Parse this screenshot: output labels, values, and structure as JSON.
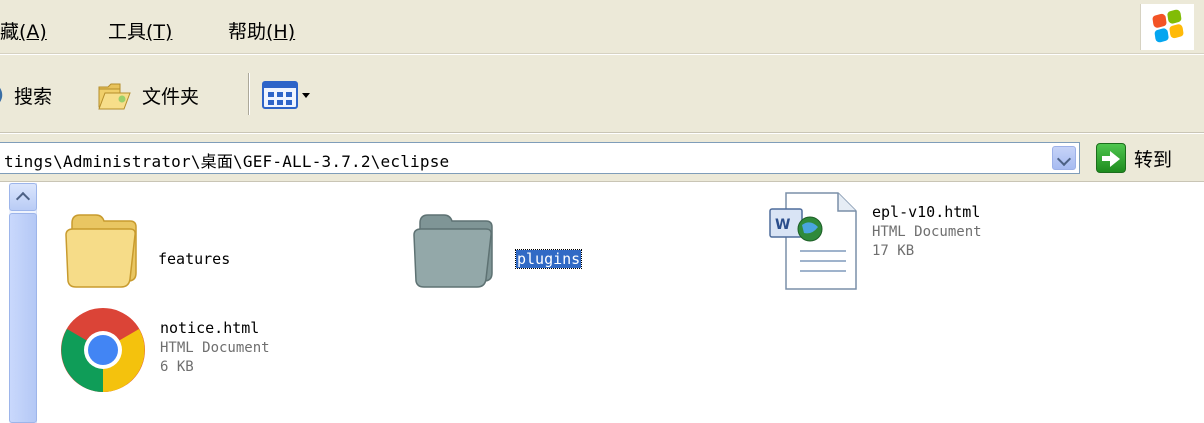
{
  "menu": {
    "items": [
      {
        "label": "藏",
        "key": "(A)"
      },
      {
        "label": "工具",
        "key": "(T)"
      },
      {
        "label": "帮助",
        "key": "(H)"
      }
    ]
  },
  "toolbar": {
    "search_label": "搜索",
    "folders_label": "文件夹",
    "views_icon": "views-icon"
  },
  "address": {
    "path": "tings\\Administrator\\桌面\\GEF-ALL-3.7.2\\eclipse",
    "go_label": "转到"
  },
  "files": [
    {
      "name": "features",
      "type": "folder"
    },
    {
      "name": "plugins",
      "type": "folder",
      "selected": true
    },
    {
      "name": "epl-v10.html",
      "type_label": "HTML Document",
      "size": "17 KB",
      "icon": "word-html-icon"
    },
    {
      "name": "notice.html",
      "type_label": "HTML Document",
      "size": "6 KB",
      "icon": "chrome-icon"
    }
  ],
  "colors": {
    "chrome_bg": "#ece9d8",
    "selection": "#316ac5",
    "folder_yellow": "#f5d77a",
    "folder_gray": "#8a9fa0"
  }
}
